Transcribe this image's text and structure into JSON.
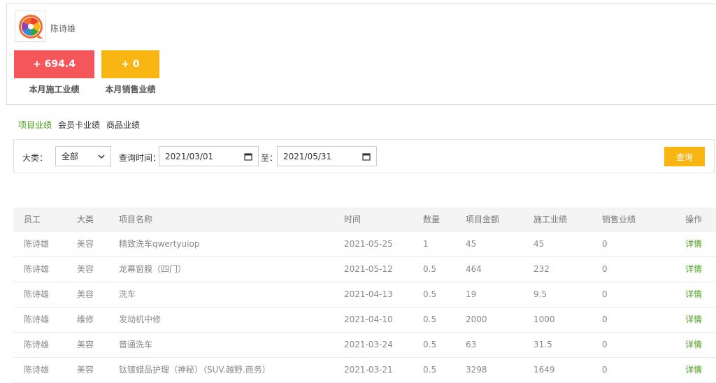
{
  "profile": {
    "name": "陈诗雄",
    "avatar_icon": "film-reel-icon",
    "stats": [
      {
        "value": "+ 694.4",
        "label": "本月施工业绩",
        "color": "#f4565a"
      },
      {
        "value": "+ 0",
        "label": "本月销售业绩",
        "color": "#f9b613"
      }
    ]
  },
  "tabs": [
    {
      "label": "项目业绩",
      "active": true
    },
    {
      "label": "会员卡业绩",
      "active": false
    },
    {
      "label": "商品业绩",
      "active": false
    }
  ],
  "filters": {
    "category_label": "大类：",
    "category_value": "全部",
    "time_label": "查询时间：",
    "start_date": "2021/03/01",
    "to_label": "至：",
    "end_date": "2021/05/31",
    "query_button": "查询"
  },
  "table": {
    "headers": [
      "员工",
      "大类",
      "项目名称",
      "时间",
      "数量",
      "项目金额",
      "施工业绩",
      "销售业绩",
      "操作"
    ],
    "rows": [
      [
        "陈诗雄",
        "美容",
        "精致洗车qwertyuiop",
        "2021-05-25",
        "1",
        "45",
        "45",
        "0",
        "详情"
      ],
      [
        "陈诗雄",
        "美容",
        "龙幕窗膜（四门）",
        "2021-05-12",
        "0.5",
        "464",
        "232",
        "0",
        "详情"
      ],
      [
        "陈诗雄",
        "美容",
        "洗车",
        "2021-04-13",
        "0.5",
        "19",
        "9.5",
        "0",
        "详情"
      ],
      [
        "陈诗雄",
        "维修",
        "发动机中修",
        "2021-04-10",
        "0.5",
        "2000",
        "1000",
        "0",
        "详情"
      ],
      [
        "陈诗雄",
        "美容",
        "普通洗车",
        "2021-03-24",
        "0.5",
        "63",
        "31.5",
        "0",
        "详情"
      ],
      [
        "陈诗雄",
        "美容",
        "钛镀蜡品护理（神秘）（SUV.越野.商务）",
        "2021-03-21",
        "0.5",
        "3298",
        "1649",
        "0",
        "详情"
      ]
    ]
  },
  "colors": {
    "accent_green": "#4a9e1f",
    "red": "#f4565a",
    "yellow": "#f9b613"
  }
}
